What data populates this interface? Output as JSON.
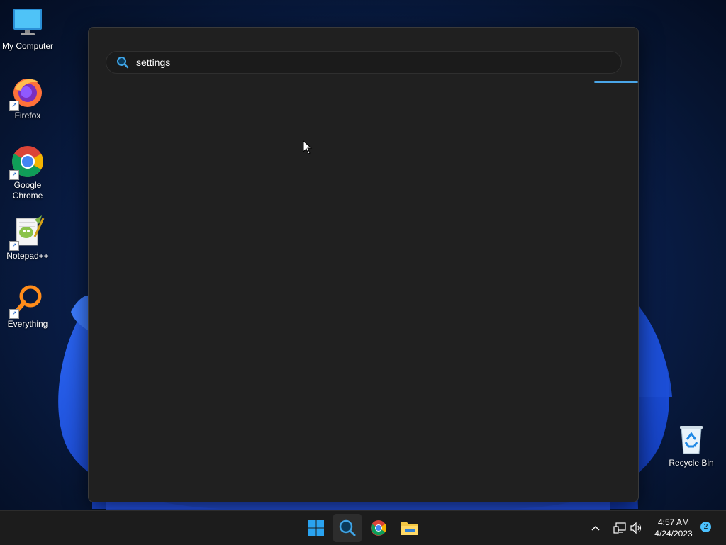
{
  "desktop": {
    "icons": [
      {
        "label": "My Computer",
        "icon": "monitor-icon"
      },
      {
        "label": "Firefox",
        "icon": "firefox-icon"
      },
      {
        "label": "Google Chrome",
        "icon": "chrome-icon"
      },
      {
        "label": "Notepad++",
        "icon": "notepadpp-icon"
      },
      {
        "label": "Everything",
        "icon": "everything-icon"
      },
      {
        "label": "Recycle Bin",
        "icon": "recycle-bin-icon"
      }
    ]
  },
  "search": {
    "query": "settings",
    "icon": "search-icon",
    "progress_color": "#4aa6e8"
  },
  "taskbar": {
    "apps": [
      {
        "name": "Start",
        "icon": "windows-start-icon"
      },
      {
        "name": "Everything",
        "icon": "everything-search-icon",
        "active": true
      },
      {
        "name": "Google Chrome",
        "icon": "chrome-icon"
      },
      {
        "name": "File Explorer",
        "icon": "folder-icon"
      }
    ],
    "tray": {
      "time": "4:57 AM",
      "date": "4/24/2023",
      "notification_count": "2"
    }
  }
}
